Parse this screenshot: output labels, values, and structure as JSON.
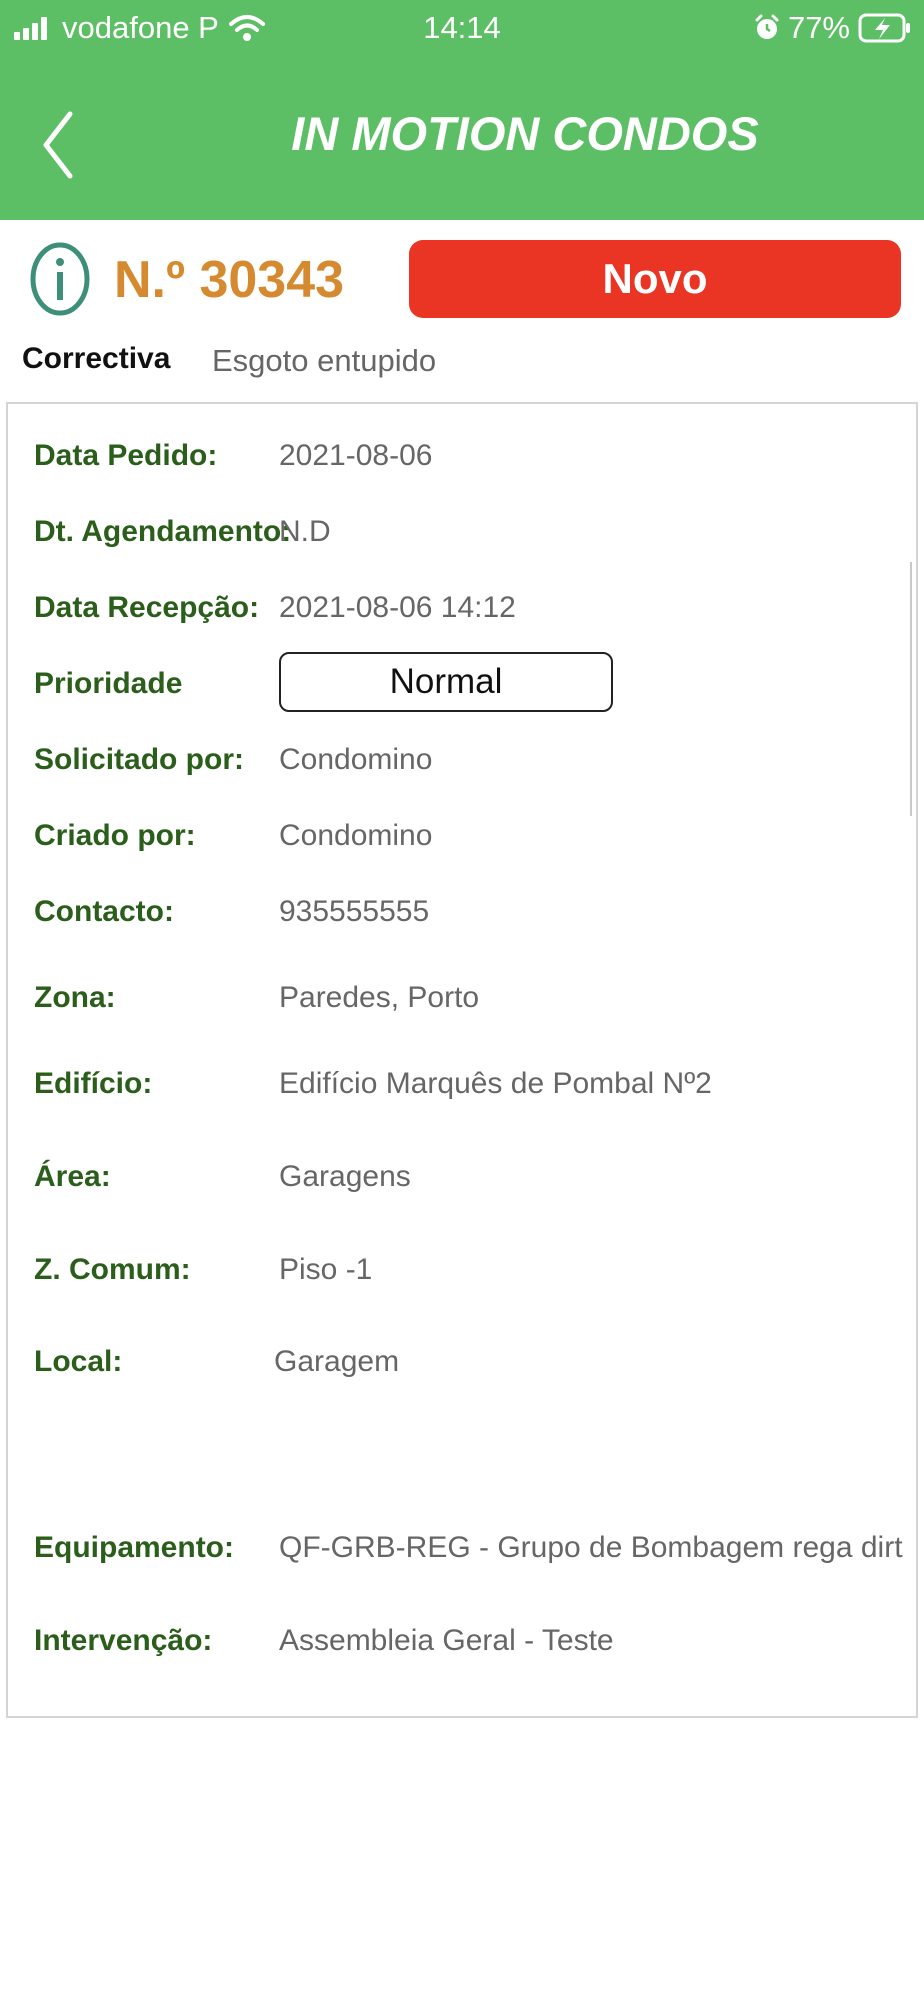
{
  "status_bar": {
    "carrier": "vodafone P",
    "time": "14:14",
    "battery": "77%"
  },
  "header": {
    "title": "IN MOTION CONDOS"
  },
  "order": {
    "number": "N.º 30343",
    "state": "Novo",
    "type": "Correctiva",
    "description": "Esgoto entupido"
  },
  "fields": {
    "data_pedido": {
      "label": "Data Pedido:",
      "value": "2021-08-06"
    },
    "dt_agendamento": {
      "label": "Dt. Agendamento:",
      "value": "N.D"
    },
    "data_recepcao": {
      "label": "Data Recepção:",
      "value": "2021-08-06 14:12"
    },
    "prioridade": {
      "label": "Prioridade",
      "value": "Normal"
    },
    "solicitado_por": {
      "label": "Solicitado por:",
      "value": "Condomino"
    },
    "criado_por": {
      "label": "Criado por:",
      "value": "Condomino"
    },
    "contacto": {
      "label": "Contacto:",
      "value": "935555555"
    },
    "zona": {
      "label": "Zona:",
      "value": "Paredes, Porto"
    },
    "edificio": {
      "label": "Edifício:",
      "value": "Edifício Marquês de Pombal Nº2"
    },
    "area": {
      "label": "Área:",
      "value": "Garagens"
    },
    "z_comum": {
      "label": "Z. Comum:",
      "value": "Piso -1"
    },
    "local": {
      "label": "Local:",
      "value": "Garagem"
    },
    "equipamento": {
      "label": "Equipamento:",
      "value": "QF-GRB-REG - Grupo de Bombagem rega dirt"
    },
    "intervencao": {
      "label": "Intervenção:",
      "value": "Assembleia Geral - Teste"
    }
  },
  "colors": {
    "header": "#5dbf65",
    "state_button": "#ea3424",
    "order_number": "#d68a30",
    "label": "#2a5e1a",
    "value": "#666666"
  },
  "icons": {
    "back": "chevron-left-icon",
    "info": "info-circle-icon",
    "wifi": "wifi-icon",
    "alarm": "alarm-icon",
    "battery": "battery-charging-icon"
  }
}
